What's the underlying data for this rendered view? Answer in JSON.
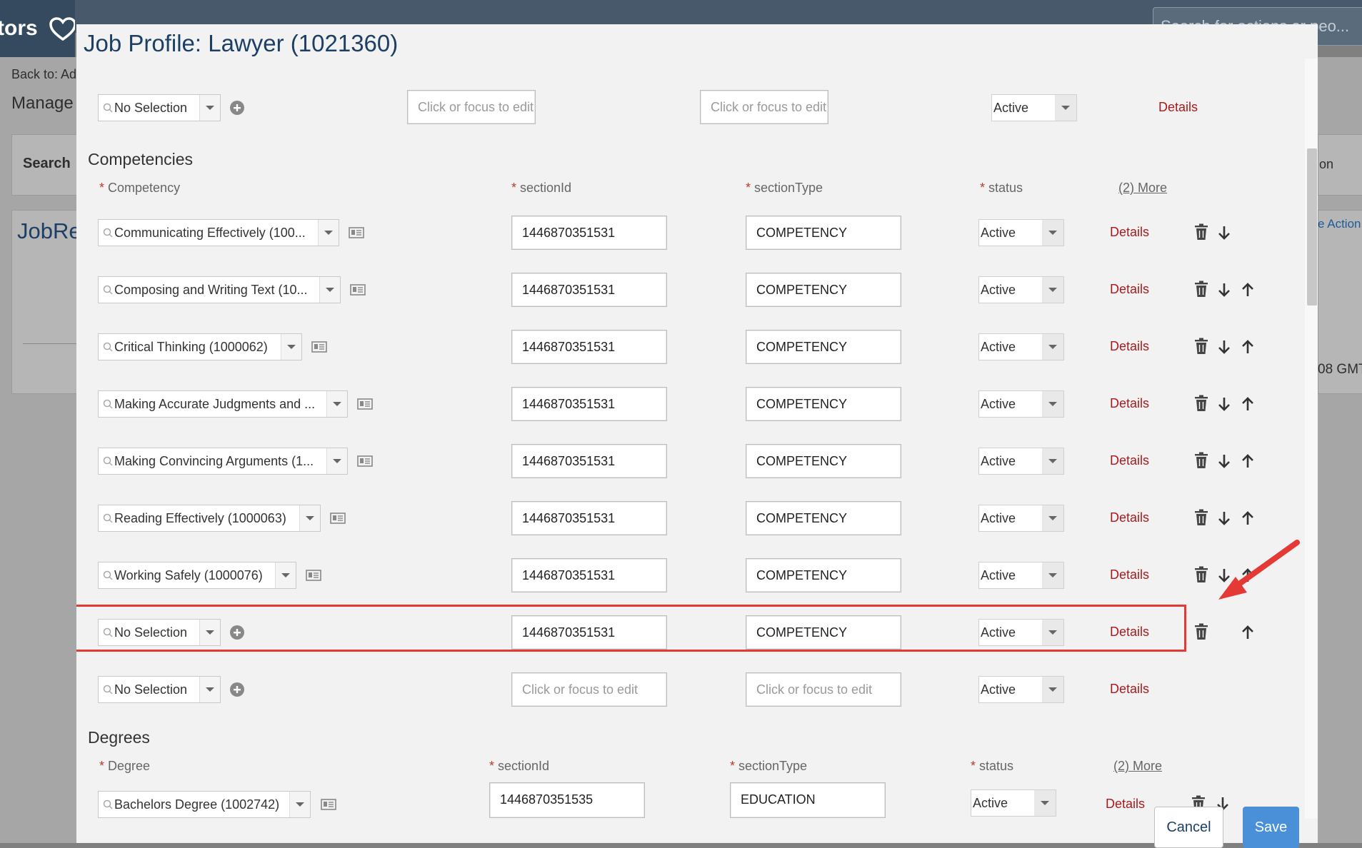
{
  "background": {
    "logo_text": "tors",
    "search_placeholder": "Search for actions or peo...",
    "back_to": "Back to: Ad",
    "manage": "Manage",
    "search_label": "Search",
    "jobre": "JobRe",
    "right_select_text": "on",
    "right_actions": "e Action",
    "right_gmt": "08 GMT"
  },
  "modal": {
    "title": "Job Profile: Lawyer (1021360)",
    "cancel_label": "Cancel",
    "save_label": "Save"
  },
  "top_row": {
    "combo": "No Selection",
    "field1_placeholder": "Click or focus to edit",
    "field2_placeholder": "Click or focus to edit",
    "status": "Active",
    "details": "Details"
  },
  "competencies": {
    "title": "Competencies",
    "headers": {
      "competency": "Competency",
      "section_id": "sectionId",
      "section_type": "sectionType",
      "status": "status",
      "more": "(2) More"
    },
    "rows": [
      {
        "name": "Communicating Effectively (100...",
        "section_id": "1446870351531",
        "section_type": "COMPETENCY",
        "status": "Active",
        "details": "Details"
      },
      {
        "name": "Composing and Writing Text (10...",
        "section_id": "1446870351531",
        "section_type": "COMPETENCY",
        "status": "Active",
        "details": "Details"
      },
      {
        "name": "Critical Thinking (1000062)",
        "section_id": "1446870351531",
        "section_type": "COMPETENCY",
        "status": "Active",
        "details": "Details"
      },
      {
        "name": "Making Accurate Judgments and ...",
        "section_id": "1446870351531",
        "section_type": "COMPETENCY",
        "status": "Active",
        "details": "Details"
      },
      {
        "name": "Making Convincing Arguments (1...",
        "section_id": "1446870351531",
        "section_type": "COMPETENCY",
        "status": "Active",
        "details": "Details"
      },
      {
        "name": "Reading Effectively (1000063)",
        "section_id": "1446870351531",
        "section_type": "COMPETENCY",
        "status": "Active",
        "details": "Details"
      },
      {
        "name": "Working Safely (1000076)",
        "section_id": "1446870351531",
        "section_type": "COMPETENCY",
        "status": "Active",
        "details": "Details"
      },
      {
        "name": "No Selection",
        "section_id": "1446870351531",
        "section_type": "COMPETENCY",
        "status": "Active",
        "details": "Details"
      },
      {
        "name": "No Selection",
        "section_id_placeholder": "Click or focus to edit",
        "section_type_placeholder": "Click or focus to edit",
        "status": "Active",
        "details": "Details"
      }
    ]
  },
  "degrees": {
    "title": "Degrees",
    "headers": {
      "degree": "Degree",
      "section_id": "sectionId",
      "section_type": "sectionType",
      "status": "status",
      "more": "(2) More"
    },
    "rows": [
      {
        "name": "Bachelors Degree (1002742)",
        "section_id": "1446870351535",
        "section_type": "EDUCATION",
        "status": "Active",
        "details": "Details"
      }
    ]
  },
  "colors": {
    "title_blue": "#1d3f66",
    "details_red": "#a61c1c",
    "highlight_red": "#e53935",
    "save_blue": "#4a90d9"
  }
}
